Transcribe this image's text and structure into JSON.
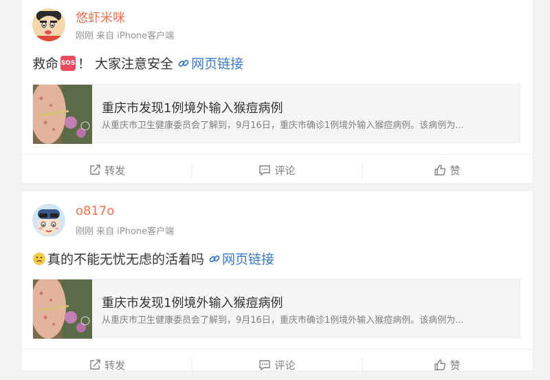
{
  "posts": [
    {
      "username": "悠虾米咪",
      "meta": "刚刚 来自 iPhone客户端",
      "text_before": "救命",
      "sos_label": "SOS",
      "text_after": "！ 大家注意安全",
      "link_label": "网页链接",
      "card": {
        "title": "重庆市发现1例境外输入猴痘病例",
        "desc": "从重庆市卫生健康委员会了解到，9月16日，重庆市确诊1例境外输入猴痘病例。该病例为..."
      },
      "actions": {
        "repost": "转发",
        "comment": "评论",
        "like": "赞"
      }
    },
    {
      "username": "o817o",
      "meta": "刚刚 来自 iPhone客户端",
      "text": "真的不能无忧无虑的活着吗",
      "link_label": "网页链接",
      "card": {
        "title": "重庆市发现1例境外输入猴痘病例",
        "desc": "从重庆市卫生健康委员会了解到，9月16日，重庆市确诊1例境外输入猴痘病例。该病例为..."
      },
      "actions": {
        "repost": "转发",
        "comment": "评论",
        "like": "赞"
      }
    }
  ],
  "colors": {
    "username": "#eb7350",
    "link": "#3a7bc8",
    "sos": "#e94b61"
  }
}
